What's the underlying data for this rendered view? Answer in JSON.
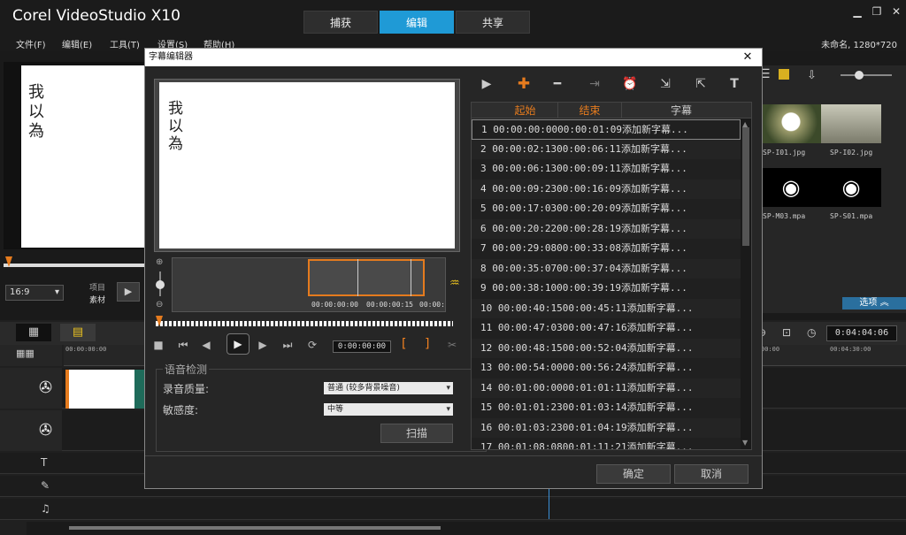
{
  "app": {
    "logo": "Corel VideoStudio X10",
    "tabs": [
      {
        "label": "捕获"
      },
      {
        "label": "编辑"
      },
      {
        "label": "共享"
      }
    ],
    "project_info": "未命名, 1280*720"
  },
  "menu": [
    "文件(F)",
    "编辑(E)",
    "工具(T)",
    "设置(S)",
    "帮助(H)"
  ],
  "preview": {
    "text": "我以為",
    "ratio": "16:9",
    "project_label": "项目",
    "clip_label": "素材"
  },
  "library": {
    "items": [
      {
        "name": "SP-I01.jpg"
      },
      {
        "name": "SP-I02.jpg"
      },
      {
        "name": "SP-M03.mpa"
      },
      {
        "name": "SP-S01.mpa"
      }
    ],
    "options_label": "选项"
  },
  "timeline": {
    "timecode": "0:04:04:06",
    "ruler_left": "00:00:00:00",
    "ruler_right_1": "00:00",
    "ruler_right_2": "00:04:30:00"
  },
  "dialog": {
    "title": "字幕编辑器",
    "preview_text": "我以為",
    "wave_tc": [
      "00:00:00:00",
      "00:00:00:15",
      "00:00:01"
    ],
    "timecode": "0:00:00:00",
    "voice": {
      "title": "语音检测",
      "quality_label": "录音质量:",
      "quality_value": "普通 (较多背景噪音)",
      "sensitivity_label": "敏感度:",
      "sensitivity_value": "中等",
      "scan_label": "扫描"
    },
    "table": {
      "headers": {
        "start": "起始",
        "end": "结束",
        "subtitle": "字幕"
      },
      "rows": [
        {
          "n": "1",
          "start": "00:00:00:00",
          "end": "00:00:01:09",
          "text": "添加新字幕..."
        },
        {
          "n": "2",
          "start": "00:00:02:13",
          "end": "00:00:06:11",
          "text": "添加新字幕..."
        },
        {
          "n": "3",
          "start": "00:00:06:13",
          "end": "00:00:09:11",
          "text": "添加新字幕..."
        },
        {
          "n": "4",
          "start": "00:00:09:23",
          "end": "00:00:16:09",
          "text": "添加新字幕..."
        },
        {
          "n": "5",
          "start": "00:00:17:03",
          "end": "00:00:20:09",
          "text": "添加新字幕..."
        },
        {
          "n": "6",
          "start": "00:00:20:22",
          "end": "00:00:28:19",
          "text": "添加新字幕..."
        },
        {
          "n": "7",
          "start": "00:00:29:08",
          "end": "00:00:33:08",
          "text": "添加新字幕..."
        },
        {
          "n": "8",
          "start": "00:00:35:07",
          "end": "00:00:37:04",
          "text": "添加新字幕..."
        },
        {
          "n": "9",
          "start": "00:00:38:10",
          "end": "00:00:39:19",
          "text": "添加新字幕..."
        },
        {
          "n": "10",
          "start": "00:00:40:15",
          "end": "00:00:45:11",
          "text": "添加新字幕..."
        },
        {
          "n": "11",
          "start": "00:00:47:03",
          "end": "00:00:47:16",
          "text": "添加新字幕..."
        },
        {
          "n": "12",
          "start": "00:00:48:15",
          "end": "00:00:52:04",
          "text": "添加新字幕..."
        },
        {
          "n": "13",
          "start": "00:00:54:00",
          "end": "00:00:56:24",
          "text": "添加新字幕..."
        },
        {
          "n": "14",
          "start": "00:01:00:00",
          "end": "00:01:01:11",
          "text": "添加新字幕..."
        },
        {
          "n": "15",
          "start": "00:01:01:23",
          "end": "00:01:03:14",
          "text": "添加新字幕..."
        },
        {
          "n": "16",
          "start": "00:01:03:23",
          "end": "00:01:04:19",
          "text": "添加新字幕..."
        },
        {
          "n": "17",
          "start": "00:01:08:08",
          "end": "00:01:11:21",
          "text": "添加新字幕..."
        }
      ]
    },
    "ok_label": "确定",
    "cancel_label": "取消"
  },
  "colors": {
    "accent": "#1f9ad6",
    "orange": "#e57b1e"
  }
}
